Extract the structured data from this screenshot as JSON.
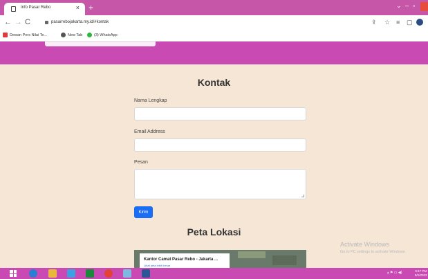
{
  "browser": {
    "tab_title": "Info Pasar Rebo",
    "tab_close": "×",
    "new_tab": "+",
    "url": "pasarrebojakarta.my.id/#kontak",
    "nav_back": "←",
    "nav_forward": "→",
    "nav_reload": "C",
    "bookmarks": [
      {
        "label": "Dewan Pers Nilai Te...",
        "color": "#e03a3a"
      },
      {
        "label": "New Tab",
        "color": "#555555"
      },
      {
        "label": "(3) WhatsApp",
        "color": "#2bb741"
      }
    ],
    "window_controls": {
      "minimize": "–",
      "restore": "▫",
      "expand": "⌄"
    }
  },
  "contact": {
    "title": "Kontak",
    "name_label": "Nama Lengkap",
    "email_label": "Email Address",
    "message_label": "Pesan",
    "submit_label": "Kirim"
  },
  "map": {
    "title": "Peta Lokasi",
    "card_title": "Kantor Camat Pasar Rebo - Jakarta ...",
    "card_link": "Lihat peta lebih besar"
  },
  "watermark": {
    "title": "Activate Windows",
    "subtitle": "Go to PC settings to activate Windows."
  },
  "taskbar": {
    "clock_time": "9:47 PM",
    "clock_date": "8/1/2023"
  },
  "colors": {
    "brand": "#c94ab2",
    "page_bg": "#f6e6d6",
    "button": "#1a6ef5"
  }
}
